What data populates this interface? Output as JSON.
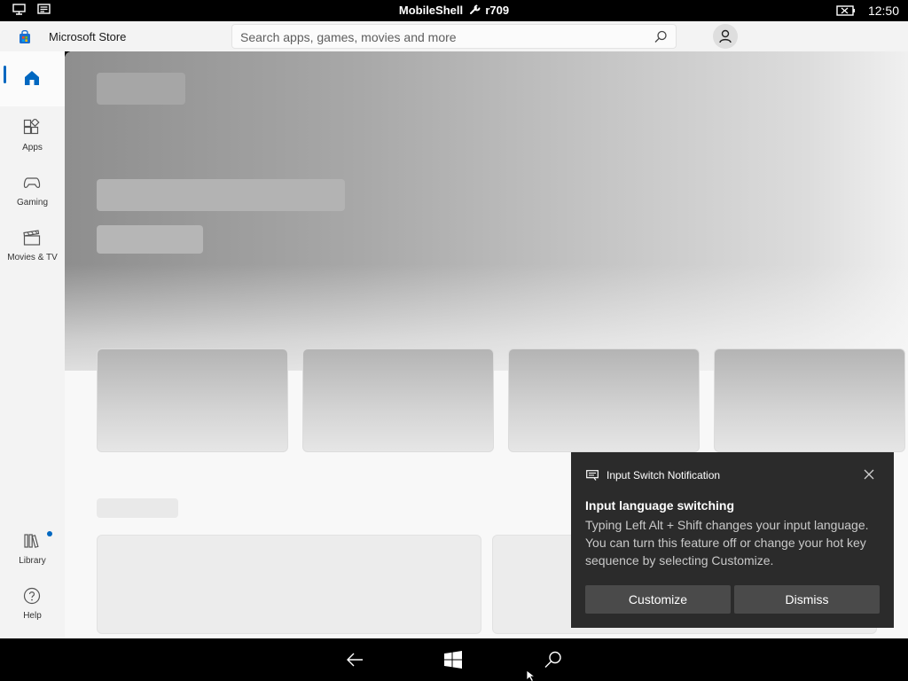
{
  "status_bar": {
    "title": "MobileShell",
    "build": "r709",
    "time": "12:50",
    "icons": [
      "phone-screen-icon",
      "message-icon",
      "wrench-icon",
      "battery-icon"
    ]
  },
  "app": {
    "name": "Microsoft Store",
    "search_placeholder": "Search apps, games, movies and more",
    "accent": "#0067c0"
  },
  "sidebar": {
    "items": [
      {
        "label": "",
        "icon": "home-icon",
        "active": true
      },
      {
        "label": "Apps",
        "icon": "apps-icon"
      },
      {
        "label": "Gaming",
        "icon": "gamepad-icon"
      },
      {
        "label": "Movies & TV",
        "icon": "clapperboard-icon"
      },
      {
        "label": "Library",
        "icon": "library-icon",
        "badge": true
      },
      {
        "label": "Help",
        "icon": "help-icon"
      }
    ]
  },
  "notification": {
    "app_name": "Input Switch Notification",
    "title": "Input language switching",
    "body": "Typing Left Alt + Shift changes your input language. You can turn this feature off or change your hot key sequence by selecting Customize.",
    "buttons": {
      "customize": "Customize",
      "dismiss": "Dismiss"
    }
  },
  "bottom_nav": {
    "icons": [
      "back-arrow-icon",
      "windows-start-icon",
      "search-icon"
    ]
  }
}
